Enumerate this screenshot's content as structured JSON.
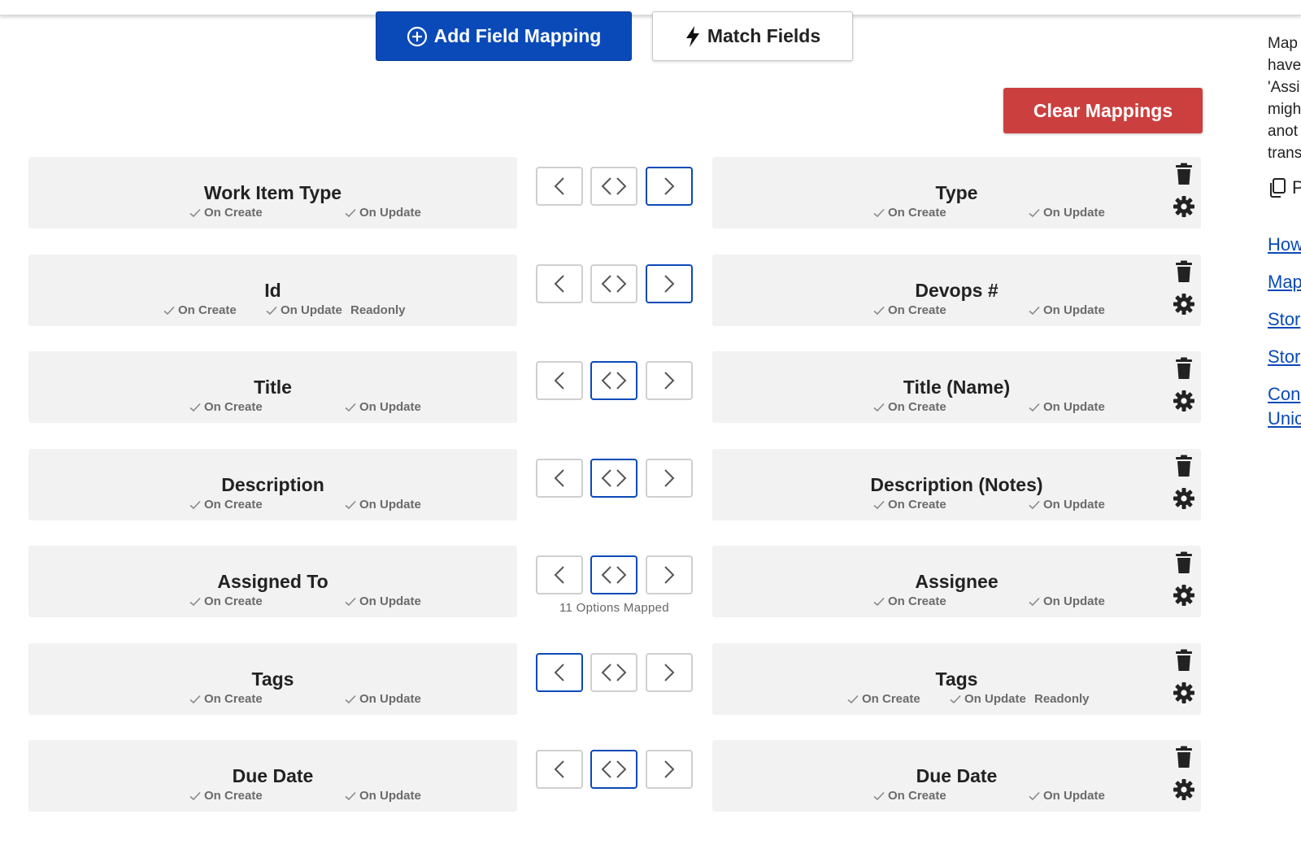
{
  "toolbar": {
    "add_label": "Add Field Mapping",
    "match_label": "Match Fields",
    "clear_label": "Clear Mappings"
  },
  "colors": {
    "primary": "#0a4ab8",
    "danger": "#cc3f3f",
    "field_bg": "#f2f2f2"
  },
  "mappings": [
    {
      "left": {
        "name": "Work Item Type",
        "flags": [
          "On Create",
          "On Update"
        ],
        "readonly": ""
      },
      "right": {
        "name": "Type",
        "flags": [
          "On Create",
          "On Update"
        ],
        "readonly": ""
      },
      "direction": "right",
      "note": ""
    },
    {
      "left": {
        "name": "Id",
        "flags": [
          "On Create",
          "On Update"
        ],
        "readonly": "Readonly"
      },
      "right": {
        "name": "Devops #",
        "flags": [
          "On Create",
          "On Update"
        ],
        "readonly": ""
      },
      "direction": "right",
      "note": ""
    },
    {
      "left": {
        "name": "Title",
        "flags": [
          "On Create",
          "On Update"
        ],
        "readonly": ""
      },
      "right": {
        "name": "Title (Name)",
        "flags": [
          "On Create",
          "On Update"
        ],
        "readonly": ""
      },
      "direction": "both",
      "note": ""
    },
    {
      "left": {
        "name": "Description",
        "flags": [
          "On Create",
          "On Update"
        ],
        "readonly": ""
      },
      "right": {
        "name": "Description (Notes)",
        "flags": [
          "On Create",
          "On Update"
        ],
        "readonly": ""
      },
      "direction": "both",
      "note": ""
    },
    {
      "left": {
        "name": "Assigned To",
        "flags": [
          "On Create",
          "On Update"
        ],
        "readonly": ""
      },
      "right": {
        "name": "Assignee",
        "flags": [
          "On Create",
          "On Update"
        ],
        "readonly": ""
      },
      "direction": "both",
      "note": "11 Options Mapped"
    },
    {
      "left": {
        "name": "Tags",
        "flags": [
          "On Create",
          "On Update"
        ],
        "readonly": ""
      },
      "right": {
        "name": "Tags",
        "flags": [
          "On Create",
          "On Update"
        ],
        "readonly": "Readonly"
      },
      "direction": "left",
      "note": ""
    },
    {
      "left": {
        "name": "Due Date",
        "flags": [
          "On Create",
          "On Update"
        ],
        "readonly": ""
      },
      "right": {
        "name": "Due Date",
        "flags": [
          "On Create",
          "On Update"
        ],
        "readonly": ""
      },
      "direction": "both",
      "note": ""
    }
  ],
  "sidebar": {
    "text_lines": [
      "Map",
      "have",
      "'Assi",
      "migh",
      "anot",
      "trans"
    ],
    "copy_label": "P",
    "links": [
      "How",
      "Map",
      "Stor",
      "Stor",
      "Con",
      "Unic"
    ]
  }
}
